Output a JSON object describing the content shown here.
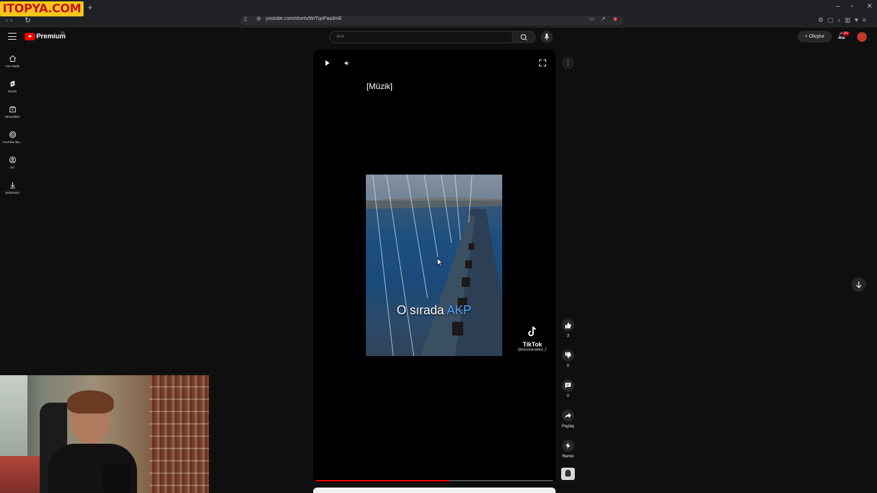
{
  "browser": {
    "watermark": "ITOPYA.COM",
    "new_tab": "+",
    "url": "youtube.com/shorts/WrTqoPaa3mE",
    "window_controls": [
      "–",
      "▫",
      "✕"
    ]
  },
  "header": {
    "logo_label": "Premium",
    "logo_region": "TR",
    "search_placeholder": "Ara",
    "create_label": "Oluştur",
    "notification_count": "9+"
  },
  "sidebar": {
    "items": [
      {
        "label": "Ana Sayfa",
        "icon": "home-icon"
      },
      {
        "label": "Shorts",
        "icon": "shorts-icon"
      },
      {
        "label": "Abonelikler",
        "icon": "subscriptions-icon"
      },
      {
        "label": "YouTube Mu...",
        "icon": "youtube-music-icon"
      },
      {
        "label": "Siz",
        "icon": "profile-icon"
      },
      {
        "label": "İndirilenler",
        "icon": "download-icon"
      }
    ]
  },
  "player": {
    "caption": "[Müzik]",
    "subtitle_plain": "O sırada",
    "subtitle_highlight": "AKP",
    "tiktok_name": "TikTok",
    "tiktok_handle": "@savunanadam_1",
    "progress_fraction": 0.56
  },
  "actions": {
    "like_count": "3",
    "dislike_count": "0",
    "comment_count": "0",
    "share_label": "Paylaş",
    "remix_label": "Remix"
  },
  "colors": {
    "accent": "#ff0000",
    "subtitle_highlight": "#4ea5ff",
    "background": "#0f0f0f"
  }
}
